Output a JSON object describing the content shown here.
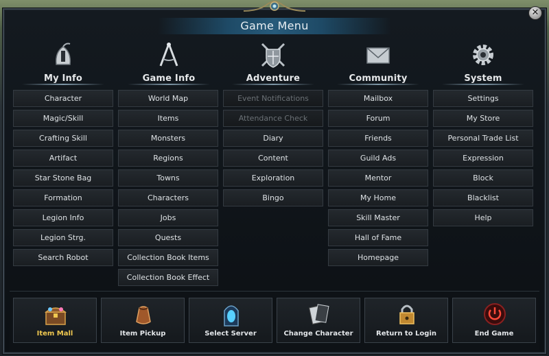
{
  "window": {
    "title": "Game Menu",
    "close_icon": "close-icon"
  },
  "columns": [
    {
      "id": "my-info",
      "header": "My Info",
      "icon": "helmet-icon",
      "items": [
        {
          "label": "Character",
          "enabled": true
        },
        {
          "label": "Magic/Skill",
          "enabled": true
        },
        {
          "label": "Crafting Skill",
          "enabled": true
        },
        {
          "label": "Artifact",
          "enabled": true
        },
        {
          "label": "Star Stone Bag",
          "enabled": true
        },
        {
          "label": "Formation",
          "enabled": true
        },
        {
          "label": "Legion Info",
          "enabled": true
        },
        {
          "label": "Legion Strg.",
          "enabled": true
        },
        {
          "label": "Search Robot",
          "enabled": true
        }
      ]
    },
    {
      "id": "game-info",
      "header": "Game Info",
      "icon": "compass-icon",
      "items": [
        {
          "label": "World Map",
          "enabled": true
        },
        {
          "label": "Items",
          "enabled": true
        },
        {
          "label": "Monsters",
          "enabled": true
        },
        {
          "label": "Regions",
          "enabled": true
        },
        {
          "label": "Towns",
          "enabled": true
        },
        {
          "label": "Characters",
          "enabled": true
        },
        {
          "label": "Jobs",
          "enabled": true
        },
        {
          "label": "Quests",
          "enabled": true
        },
        {
          "label": "Collection Book Items",
          "enabled": true
        },
        {
          "label": "Collection Book Effect",
          "enabled": true
        }
      ]
    },
    {
      "id": "adventure",
      "header": "Adventure",
      "icon": "shield-swords-icon",
      "items": [
        {
          "label": "Event Notifications",
          "enabled": false
        },
        {
          "label": "Attendance Check",
          "enabled": false
        },
        {
          "label": "Diary",
          "enabled": true
        },
        {
          "label": "Content",
          "enabled": true
        },
        {
          "label": "Exploration",
          "enabled": true
        },
        {
          "label": "Bingo",
          "enabled": true
        }
      ]
    },
    {
      "id": "community",
      "header": "Community",
      "icon": "envelope-icon",
      "items": [
        {
          "label": "Mailbox",
          "enabled": true
        },
        {
          "label": "Forum",
          "enabled": true
        },
        {
          "label": "Friends",
          "enabled": true
        },
        {
          "label": "Guild Ads",
          "enabled": true
        },
        {
          "label": "Mentor",
          "enabled": true
        },
        {
          "label": "My Home",
          "enabled": true
        },
        {
          "label": "Skill Master",
          "enabled": true
        },
        {
          "label": "Hall of Fame",
          "enabled": true
        },
        {
          "label": "Homepage",
          "enabled": true
        }
      ]
    },
    {
      "id": "system",
      "header": "System",
      "icon": "gear-icon",
      "items": [
        {
          "label": "Settings",
          "enabled": true
        },
        {
          "label": "My Store",
          "enabled": true
        },
        {
          "label": "Personal Trade List",
          "enabled": true
        },
        {
          "label": "Expression",
          "enabled": true
        },
        {
          "label": "Block",
          "enabled": true
        },
        {
          "label": "Blacklist",
          "enabled": true
        },
        {
          "label": "Help",
          "enabled": true
        }
      ]
    }
  ],
  "bottom_buttons": [
    {
      "label": "Item Mall",
      "icon": "treasure-chest-icon",
      "highlight": true
    },
    {
      "label": "Item Pickup",
      "icon": "pouch-icon",
      "highlight": false
    },
    {
      "label": "Select Server",
      "icon": "portal-icon",
      "highlight": false
    },
    {
      "label": "Change Character",
      "icon": "cards-icon",
      "highlight": false
    },
    {
      "label": "Return to Login",
      "icon": "padlock-icon",
      "highlight": false
    },
    {
      "label": "End Game",
      "icon": "power-icon",
      "highlight": false
    }
  ],
  "colors": {
    "accent_gold": "#f0c850",
    "title_bar": "#275a7a",
    "disabled_text": "#6b7176"
  }
}
